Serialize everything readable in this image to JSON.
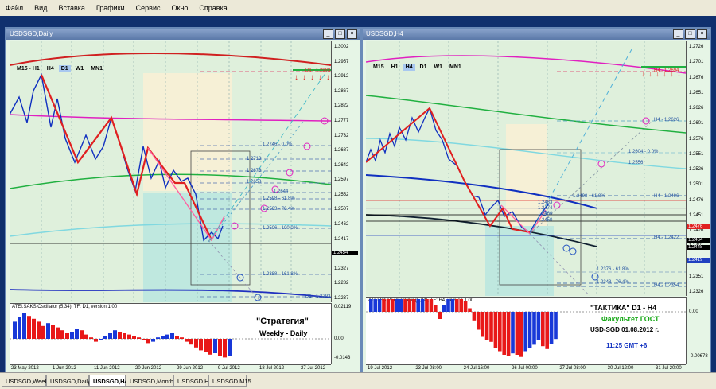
{
  "menu": [
    "Файл",
    "Вид",
    "Вставка",
    "Графики",
    "Сервис",
    "Окно",
    "Справка"
  ],
  "timeframes": [
    "M15",
    "H1",
    "H4",
    "D1",
    "W1",
    "MN1"
  ],
  "tabs": [
    "USDSGD,Weekly",
    "USDSGD,Daily",
    "USDSGD,H4",
    "USDSGD,Monthly",
    "USDSGD,H1",
    "USDSGD,M15"
  ],
  "active_tab": "USDSGD,H4",
  "daily": {
    "title": "USDSGD,Daily",
    "tf_first": "M15 - H1",
    "active_tf": "D1",
    "price_ticks": [
      "1.3002",
      "1.2957",
      "1.2912",
      "1.2867",
      "1.2822",
      "1.2777",
      "1.2732",
      "1.2687",
      "1.2642",
      "1.2597",
      "1.2552",
      "1.2507",
      "1.2462",
      "1.2417",
      "1.2372",
      "1.2327",
      "1.2282",
      "1.2237"
    ],
    "current_price": "1.2454",
    "osc_label": "ATEI.SAKS.Oscillator (5,34), TF: D1, version 1.00",
    "osc_ticks": [
      "0.02119",
      "0.00",
      "-0.0143"
    ],
    "time_labels": [
      "23 May 2012",
      "1 Jun 2012",
      "11 Jun 2012",
      "20 Jun 2012",
      "29 Jun 2012",
      "9 Jul 2012",
      "18 Jul 2012",
      "27 Jul 2012"
    ],
    "labels": {
      "zero": "(0)",
      "kt1_left": "Кт-1",
      "kt2": "Кт-2",
      "kt1": "Кт-1",
      "zero2": "(0)",
      "kt1_blue": "(Кт-1)",
      "kt1_small": "(Кт-1)",
      "kt2_small": "Кт-2",
      "kt1_low": "Кт-1",
      "kt3a": "Кт-3",
      "kt3b": "Кт-3"
    },
    "level_labels": [
      "D1 - 1.2993",
      "1.2746 - 0.0%",
      "1.2713",
      "1.2676",
      "1.2658",
      "1.2644",
      "1.2598 - 61.8%",
      "1.2563 - 76.4%",
      "1.2506 - 100.0%",
      "1.2388 - 161.8%",
      "D1 - 1.2293",
      "1.2223 - 200.0%"
    ],
    "osc_values": [
      0.012,
      0.015,
      0.018,
      0.016,
      0.014,
      0.012,
      0.009,
      0.011,
      0.01,
      0.008,
      0.006,
      0.004,
      0.005,
      0.007,
      0.006,
      0.003,
      0.001,
      -0.002,
      -0.001,
      0.002,
      0.004,
      0.006,
      0.005,
      0.004,
      0.003,
      0.002,
      0.001,
      -0.001,
      -0.003,
      -0.002,
      0.001,
      0.002,
      0.003,
      0.004,
      0.002,
      0.001,
      -0.002,
      -0.004,
      -0.006,
      -0.008,
      -0.009,
      -0.011,
      -0.01,
      -0.012,
      -0.013,
      -0.012
    ],
    "strategy_title": "\"Стратегия\"",
    "strategy_sub": "Weekly - Daily"
  },
  "h4": {
    "title": "USDSGD,H4",
    "active_tf": "H4",
    "price_ticks": [
      "1.2726",
      "1.2701",
      "1.2676",
      "1.2651",
      "1.2626",
      "1.2601",
      "1.2576",
      "1.2551",
      "1.2526",
      "1.2501",
      "1.2476",
      "1.2451",
      "1.2426",
      "1.2401",
      "1.2376",
      "1.2351",
      "1.2326"
    ],
    "price_highlights": [
      "1.2476",
      "1.2464",
      "1.2448",
      "1.2419"
    ],
    "osc_label": "ATEI.SAKS.Oscillator (5,34), TF: H4, version 1.00",
    "osc_ticks": [
      "0.00",
      "-0.00678"
    ],
    "time_labels": [
      "19 Jul 2012",
      "23 Jul 08:00",
      "24 Jul 16:00",
      "26 Jul 00:00",
      "27 Jul 08:00",
      "30 Jul 12:00",
      "31 Jul 20:00"
    ],
    "labels": {
      "zero": "(0)",
      "kt1_blue": "(Кт-1)",
      "kt2": "Кт-2",
      "zero2": "(0)",
      "kt1_small": "(Кт-1)",
      "kt2_small": "Кт-2",
      "kt1": "Кт-1",
      "kt1_low": "Кт-1",
      "kt3": "Кт-3",
      "kt3_paren": "(Кт-3)"
    },
    "level_labels": [
      "H4 - 1.2694",
      "H4 - 1.2626",
      "1.2604 - 0.0%",
      "1.2556",
      "1.2498 - 61.8%",
      "H4 - 1.2496",
      "1.2483",
      "1.2474",
      "1.2460",
      "1.2450",
      "H4 - 1.2422",
      "1.2376 - 61.8%",
      "1.2348 - 76.4%",
      "H4 - 1.2354"
    ],
    "osc_values": [
      0.004,
      0.005,
      0.006,
      0.0055,
      0.005,
      0.004,
      0.0045,
      0.005,
      0.0042,
      0.003,
      0.002,
      0.0025,
      0.0035,
      0.003,
      0.002,
      0.001,
      -0.001,
      0.001,
      0.003,
      0.004,
      0.0038,
      0.003,
      0.0015,
      0.0005,
      -0.0012,
      -0.0025,
      -0.0035,
      -0.004,
      -0.0042,
      -0.005,
      -0.0055,
      -0.006,
      -0.0062,
      -0.0058,
      -0.006,
      -0.0063,
      -0.0055,
      -0.005,
      -0.0046,
      -0.004,
      -0.0048,
      -0.0052,
      -0.0045,
      -0.0038
    ],
    "tactic": {
      "title": "\"ТАКТИКА\"   D1 - H4",
      "faculty": "Факультет ГОСТ",
      "pair_date": "USD-SGD   01.08.2012 г.",
      "time": "11:25   GMT +6"
    }
  }
}
